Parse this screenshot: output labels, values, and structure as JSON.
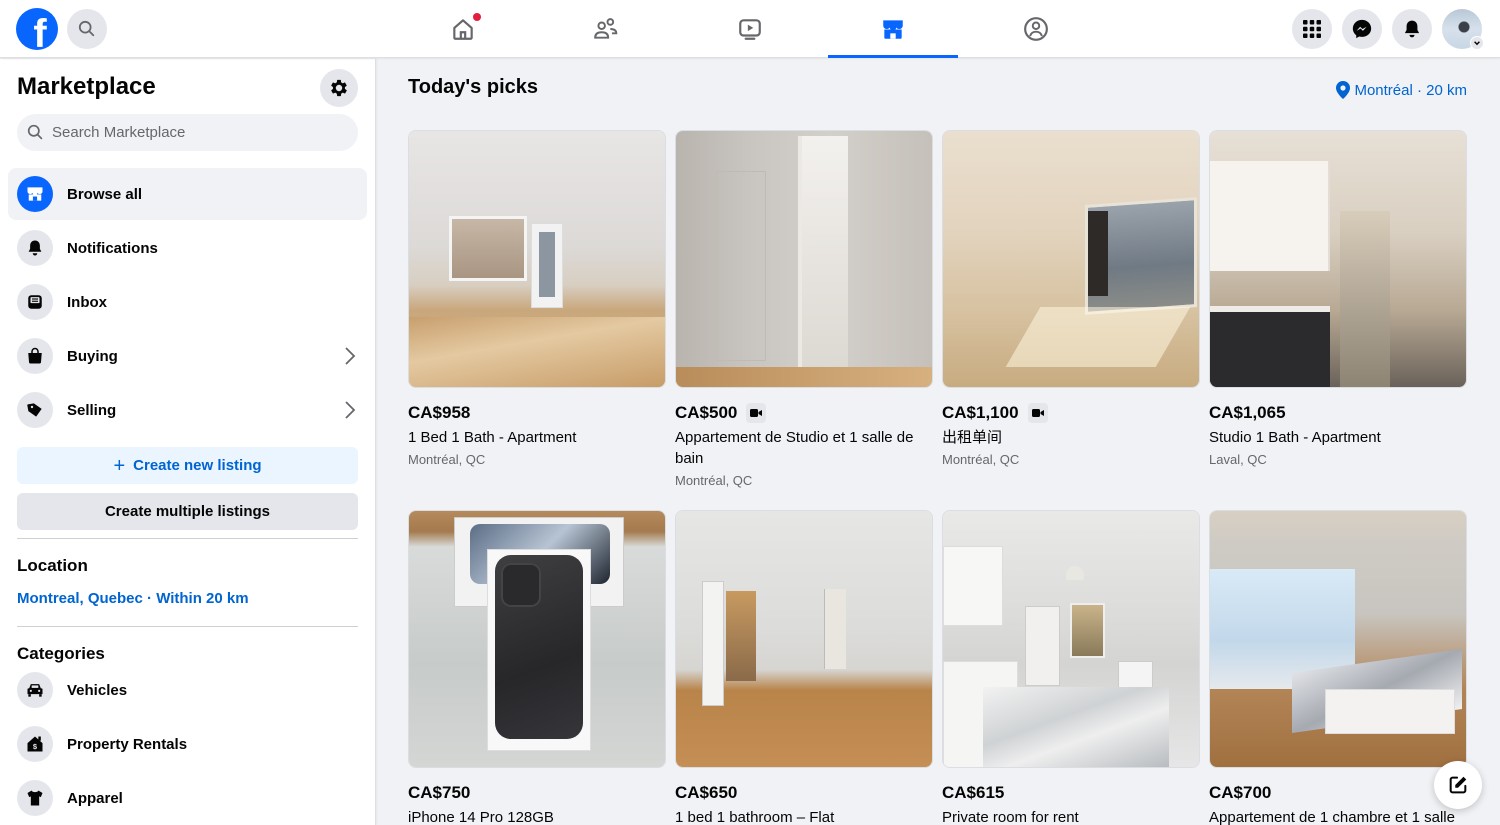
{
  "topbar": {
    "logo": "facebook-logo",
    "search_icon": "search-icon",
    "nav_tabs": [
      {
        "name": "home",
        "icon": "home-icon",
        "has_notification": true,
        "active": false
      },
      {
        "name": "friends",
        "icon": "friends-icon",
        "has_notification": false,
        "active": false
      },
      {
        "name": "video",
        "icon": "video-icon",
        "has_notification": false,
        "active": false
      },
      {
        "name": "marketplace",
        "icon": "marketplace-icon",
        "has_notification": false,
        "active": true
      },
      {
        "name": "groups",
        "icon": "groups-icon",
        "has_notification": false,
        "active": false
      }
    ],
    "right_buttons": [
      "menu-grid-icon",
      "messenger-icon",
      "bell-icon"
    ],
    "accent_color": "#0866ff",
    "notification_color": "#e41e3f"
  },
  "sidebar": {
    "title": "Marketplace",
    "search_placeholder": "Search Marketplace",
    "nav": [
      {
        "label": "Browse all",
        "icon": "storefront-icon",
        "active": true
      },
      {
        "label": "Notifications",
        "icon": "bell-icon"
      },
      {
        "label": "Inbox",
        "icon": "inbox-icon"
      },
      {
        "label": "Buying",
        "icon": "shopping-bag-icon",
        "has_chevron": true
      },
      {
        "label": "Selling",
        "icon": "price-tag-icon",
        "has_chevron": true
      }
    ],
    "create_listing_label": "Create new listing",
    "create_multiple_label": "Create multiple listings",
    "location_title": "Location",
    "location_value": "Montreal, Quebec · Within 20 km",
    "categories_title": "Categories",
    "categories": [
      {
        "label": "Vehicles",
        "icon": "car-icon"
      },
      {
        "label": "Property Rentals",
        "icon": "house-dollar-icon"
      },
      {
        "label": "Apparel",
        "icon": "tshirt-icon"
      }
    ]
  },
  "main": {
    "title": "Today's picks",
    "location_filter": "Montréal · 20 km",
    "listings": [
      {
        "price": "CA$958",
        "title": "1 Bed 1 Bath - Apartment",
        "location": "Montréal, QC",
        "video": false
      },
      {
        "price": "CA$500",
        "title": "Appartement de Studio et 1 salle de bain",
        "location": "Montréal, QC",
        "video": true
      },
      {
        "price": "CA$1,100",
        "title": "出租单间",
        "location": "Montréal, QC",
        "video": true
      },
      {
        "price": "CA$1,065",
        "title": "Studio 1 Bath - Apartment",
        "location": "Laval, QC",
        "video": false
      },
      {
        "price": "CA$750",
        "title": "iPhone 14 Pro 128GB",
        "location": "",
        "video": false
      },
      {
        "price": "CA$650",
        "title": "1 bed 1 bathroom – Flat",
        "location": "",
        "video": false
      },
      {
        "price": "CA$615",
        "title": "Private room for rent",
        "location": "",
        "video": false
      },
      {
        "price": "CA$700",
        "title": "Appartement de 1 chambre et 1 salle",
        "location": "",
        "video": false
      }
    ]
  },
  "fab": {
    "icon": "compose-icon"
  }
}
